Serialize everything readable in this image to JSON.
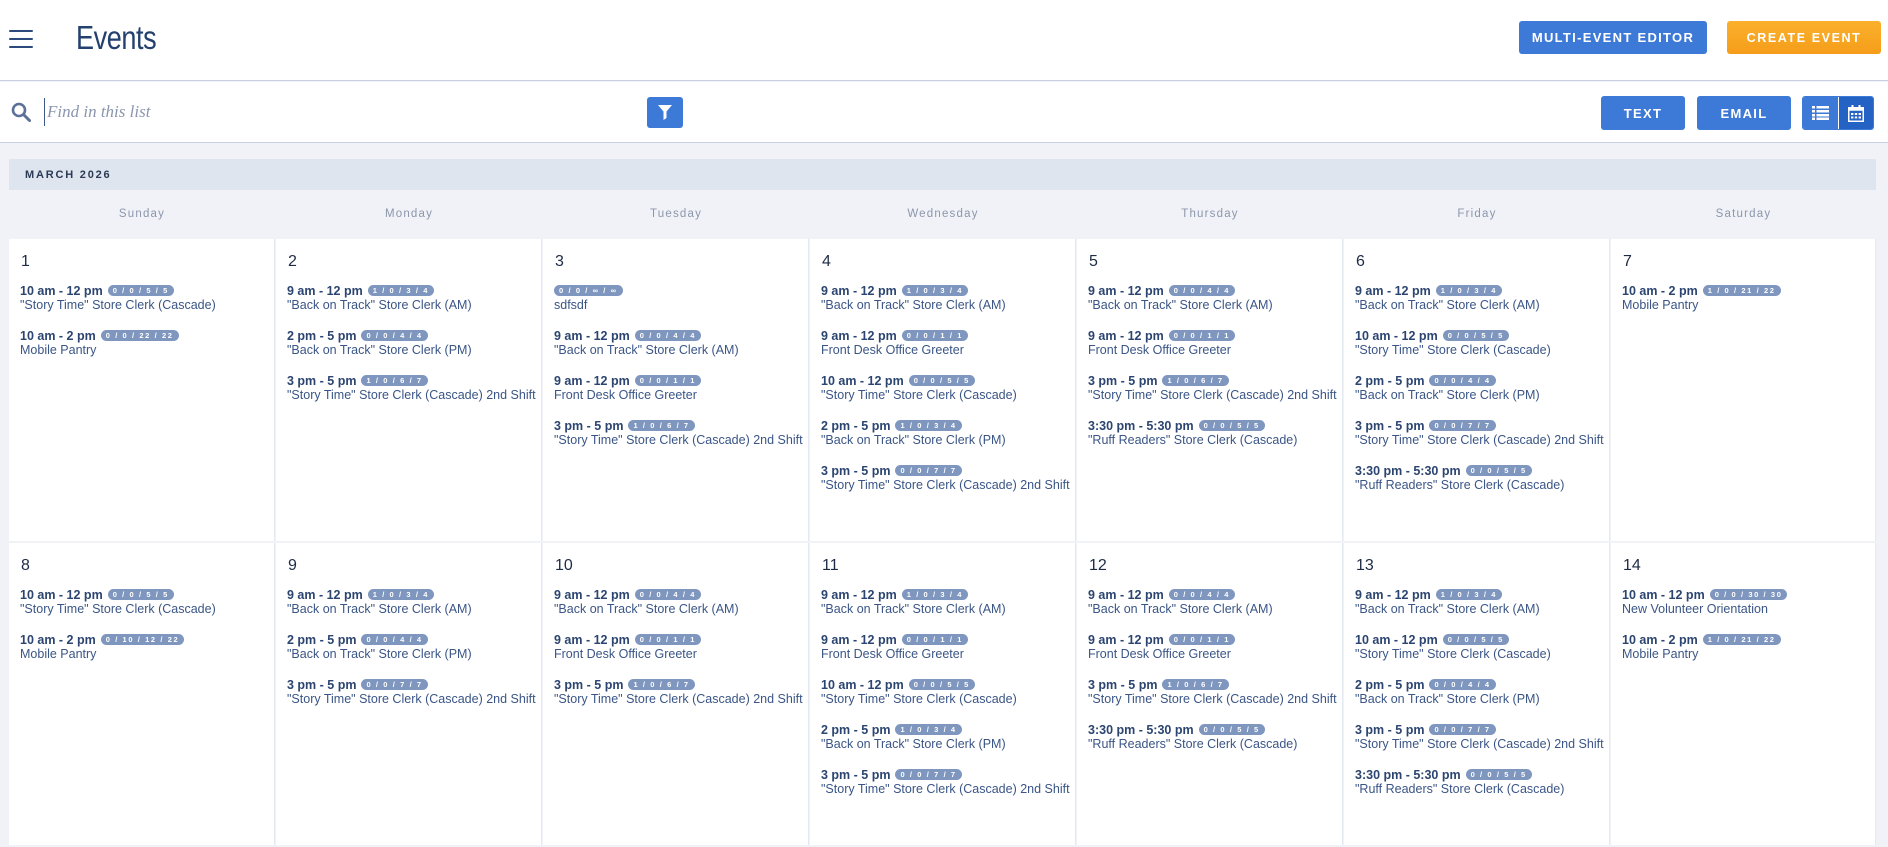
{
  "header": {
    "title": "Events",
    "multi_event_editor": "MULTI-EVENT EDITOR",
    "create_event": "CREATE EVENT"
  },
  "toolbar": {
    "search_placeholder": "Find in this list",
    "text_button": "TEXT",
    "email_button": "EMAIL"
  },
  "calendar": {
    "month_label": "MARCH 2026",
    "weekdays": [
      "Sunday",
      "Monday",
      "Tuesday",
      "Wednesday",
      "Thursday",
      "Friday",
      "Saturday"
    ],
    "weeks": [
      [
        {
          "day": "1",
          "events": [
            {
              "time": "10 am - 12 pm",
              "badge": "0 / 0 / 5 / 5",
              "name": "\"Story Time\" Store Clerk (Cascade)"
            },
            {
              "time": "10 am - 2 pm",
              "badge": "0 / 0 / 22 / 22",
              "name": "Mobile Pantry"
            }
          ]
        },
        {
          "day": "2",
          "events": [
            {
              "time": "9 am - 12 pm",
              "badge": "1 / 0 / 3 / 4",
              "name": "\"Back on Track\" Store Clerk (AM)"
            },
            {
              "time": "2 pm - 5 pm",
              "badge": "0 / 0 / 4 / 4",
              "name": "\"Back on Track\" Store Clerk (PM)"
            },
            {
              "time": "3 pm - 5 pm",
              "badge": "1 / 0 / 6 / 7",
              "name": "\"Story Time\" Store Clerk (Cascade) 2nd Shift"
            }
          ]
        },
        {
          "day": "3",
          "events": [
            {
              "time": "",
              "badge": "0 / 0 / ∞ / ∞",
              "name": "sdfsdf"
            },
            {
              "time": "9 am - 12 pm",
              "badge": "0 / 0 / 4 / 4",
              "name": "\"Back on Track\" Store Clerk (AM)"
            },
            {
              "time": "9 am - 12 pm",
              "badge": "0 / 0 / 1 / 1",
              "name": "Front Desk Office Greeter"
            },
            {
              "time": "3 pm - 5 pm",
              "badge": "1 / 0 / 6 / 7",
              "name": "\"Story Time\" Store Clerk (Cascade) 2nd Shift"
            }
          ]
        },
        {
          "day": "4",
          "events": [
            {
              "time": "9 am - 12 pm",
              "badge": "1 / 0 / 3 / 4",
              "name": "\"Back on Track\" Store Clerk (AM)"
            },
            {
              "time": "9 am - 12 pm",
              "badge": "0 / 0 / 1 / 1",
              "name": "Front Desk Office Greeter"
            },
            {
              "time": "10 am - 12 pm",
              "badge": "0 / 0 / 5 / 5",
              "name": "\"Story Time\" Store Clerk (Cascade)"
            },
            {
              "time": "2 pm - 5 pm",
              "badge": "1 / 0 / 3 / 4",
              "name": "\"Back on Track\" Store Clerk (PM)"
            },
            {
              "time": "3 pm - 5 pm",
              "badge": "0 / 0 / 7 / 7",
              "name": "\"Story Time\" Store Clerk (Cascade) 2nd Shift"
            }
          ]
        },
        {
          "day": "5",
          "events": [
            {
              "time": "9 am - 12 pm",
              "badge": "0 / 0 / 4 / 4",
              "name": "\"Back on Track\" Store Clerk (AM)"
            },
            {
              "time": "9 am - 12 pm",
              "badge": "0 / 0 / 1 / 1",
              "name": "Front Desk Office Greeter"
            },
            {
              "time": "3 pm - 5 pm",
              "badge": "1 / 0 / 6 / 7",
              "name": "\"Story Time\" Store Clerk (Cascade) 2nd Shift"
            },
            {
              "time": "3:30 pm - 5:30 pm",
              "badge": "0 / 0 / 5 / 5",
              "name": "\"Ruff Readers\" Store Clerk (Cascade)"
            }
          ]
        },
        {
          "day": "6",
          "events": [
            {
              "time": "9 am - 12 pm",
              "badge": "1 / 0 / 3 / 4",
              "name": "\"Back on Track\" Store Clerk (AM)"
            },
            {
              "time": "10 am - 12 pm",
              "badge": "0 / 0 / 5 / 5",
              "name": "\"Story Time\" Store Clerk (Cascade)"
            },
            {
              "time": "2 pm - 5 pm",
              "badge": "0 / 0 / 4 / 4",
              "name": "\"Back on Track\" Store Clerk (PM)"
            },
            {
              "time": "3 pm - 5 pm",
              "badge": "0 / 0 / 7 / 7",
              "name": "\"Story Time\" Store Clerk (Cascade) 2nd Shift"
            },
            {
              "time": "3:30 pm - 5:30 pm",
              "badge": "0 / 0 / 5 / 5",
              "name": "\"Ruff Readers\" Store Clerk (Cascade)"
            }
          ]
        },
        {
          "day": "7",
          "events": [
            {
              "time": "10 am - 2 pm",
              "badge": "1 / 0 / 21 / 22",
              "name": "Mobile Pantry"
            }
          ]
        }
      ],
      [
        {
          "day": "8",
          "events": [
            {
              "time": "10 am - 12 pm",
              "badge": "0 / 0 / 5 / 5",
              "name": "\"Story Time\" Store Clerk (Cascade)"
            },
            {
              "time": "10 am - 2 pm",
              "badge": "0 / 10 / 12 / 22",
              "name": "Mobile Pantry"
            }
          ]
        },
        {
          "day": "9",
          "events": [
            {
              "time": "9 am - 12 pm",
              "badge": "1 / 0 / 3 / 4",
              "name": "\"Back on Track\" Store Clerk (AM)"
            },
            {
              "time": "2 pm - 5 pm",
              "badge": "0 / 0 / 4 / 4",
              "name": "\"Back on Track\" Store Clerk (PM)"
            },
            {
              "time": "3 pm - 5 pm",
              "badge": "0 / 0 / 7 / 7",
              "name": "\"Story Time\" Store Clerk (Cascade) 2nd Shift"
            }
          ]
        },
        {
          "day": "10",
          "events": [
            {
              "time": "9 am - 12 pm",
              "badge": "0 / 0 / 4 / 4",
              "name": "\"Back on Track\" Store Clerk (AM)"
            },
            {
              "time": "9 am - 12 pm",
              "badge": "0 / 0 / 1 / 1",
              "name": "Front Desk Office Greeter"
            },
            {
              "time": "3 pm - 5 pm",
              "badge": "1 / 0 / 6 / 7",
              "name": "\"Story Time\" Store Clerk (Cascade) 2nd Shift"
            }
          ]
        },
        {
          "day": "11",
          "events": [
            {
              "time": "9 am - 12 pm",
              "badge": "1 / 0 / 3 / 4",
              "name": "\"Back on Track\" Store Clerk (AM)"
            },
            {
              "time": "9 am - 12 pm",
              "badge": "0 / 0 / 1 / 1",
              "name": "Front Desk Office Greeter"
            },
            {
              "time": "10 am - 12 pm",
              "badge": "0 / 0 / 5 / 5",
              "name": "\"Story Time\" Store Clerk (Cascade)"
            },
            {
              "time": "2 pm - 5 pm",
              "badge": "1 / 0 / 3 / 4",
              "name": "\"Back on Track\" Store Clerk (PM)"
            },
            {
              "time": "3 pm - 5 pm",
              "badge": "0 / 0 / 7 / 7",
              "name": "\"Story Time\" Store Clerk (Cascade) 2nd Shift"
            }
          ]
        },
        {
          "day": "12",
          "events": [
            {
              "time": "9 am - 12 pm",
              "badge": "0 / 0 / 4 / 4",
              "name": "\"Back on Track\" Store Clerk (AM)"
            },
            {
              "time": "9 am - 12 pm",
              "badge": "0 / 0 / 1 / 1",
              "name": "Front Desk Office Greeter"
            },
            {
              "time": "3 pm - 5 pm",
              "badge": "1 / 0 / 6 / 7",
              "name": "\"Story Time\" Store Clerk (Cascade) 2nd Shift"
            },
            {
              "time": "3:30 pm - 5:30 pm",
              "badge": "0 / 0 / 5 / 5",
              "name": "\"Ruff Readers\" Store Clerk (Cascade)"
            }
          ]
        },
        {
          "day": "13",
          "events": [
            {
              "time": "9 am - 12 pm",
              "badge": "1 / 0 / 3 / 4",
              "name": "\"Back on Track\" Store Clerk (AM)"
            },
            {
              "time": "10 am - 12 pm",
              "badge": "0 / 0 / 5 / 5",
              "name": "\"Story Time\" Store Clerk (Cascade)"
            },
            {
              "time": "2 pm - 5 pm",
              "badge": "0 / 0 / 4 / 4",
              "name": "\"Back on Track\" Store Clerk (PM)"
            },
            {
              "time": "3 pm - 5 pm",
              "badge": "0 / 0 / 7 / 7",
              "name": "\"Story Time\" Store Clerk (Cascade) 2nd Shift"
            },
            {
              "time": "3:30 pm - 5:30 pm",
              "badge": "0 / 0 / 5 / 5",
              "name": "\"Ruff Readers\" Store Clerk (Cascade)"
            }
          ]
        },
        {
          "day": "14",
          "events": [
            {
              "time": "10 am - 12 pm",
              "badge": "0 / 0 / 30 / 30",
              "name": "New Volunteer Orientation"
            },
            {
              "time": "10 am - 2 pm",
              "badge": "1 / 0 / 21 / 22",
              "name": "Mobile Pantry"
            }
          ]
        }
      ]
    ]
  },
  "icons": {
    "menu": "hamburger-icon",
    "search": "search-icon",
    "filter": "filter-icon",
    "list_view": "list-icon",
    "calendar_view": "calendar-icon"
  },
  "colors": {
    "primary_blue": "#3d79d6",
    "accent_orange": "#f7a620",
    "badge": "#7f96bf",
    "title": "#23406e"
  }
}
